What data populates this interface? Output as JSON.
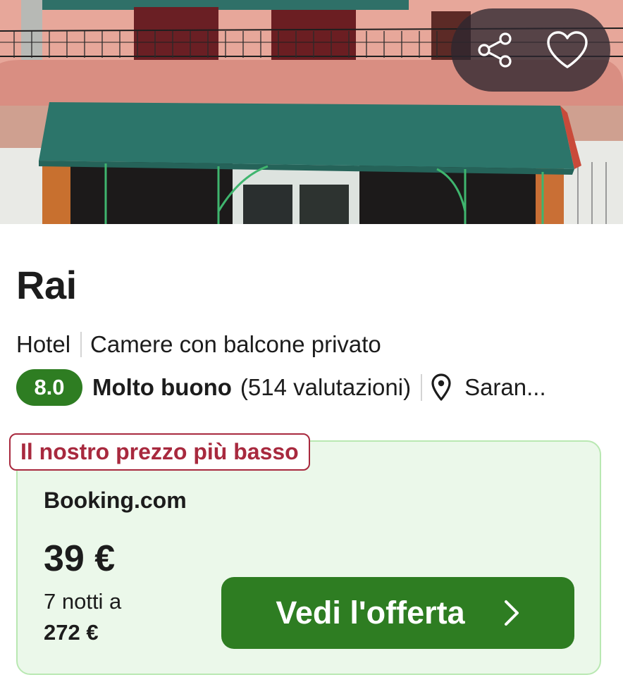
{
  "hotel": {
    "name": "Rai",
    "type": "Hotel",
    "feature": "Camere con balcone privato",
    "score": "8.0",
    "rating_label": "Molto buono",
    "review_count": "(514 valutazioni)",
    "location": "Saran..."
  },
  "photo_actions": {
    "share_icon": "share-icon",
    "favorite_icon": "heart-icon"
  },
  "offer": {
    "badge": "Il nostro prezzo più basso",
    "provider": "Booking.com",
    "price": "39 €",
    "nights_text": "7 notti a",
    "total": "272 €",
    "cta_label": "Vedi l'offerta",
    "cta_icon": "chevron-right-icon"
  },
  "colors": {
    "score_green": "#2e7d22",
    "cta_green": "#2e7d22",
    "badge_red": "#a8293e",
    "card_bg": "#ebf8ea",
    "card_border": "#b9e8b2"
  }
}
